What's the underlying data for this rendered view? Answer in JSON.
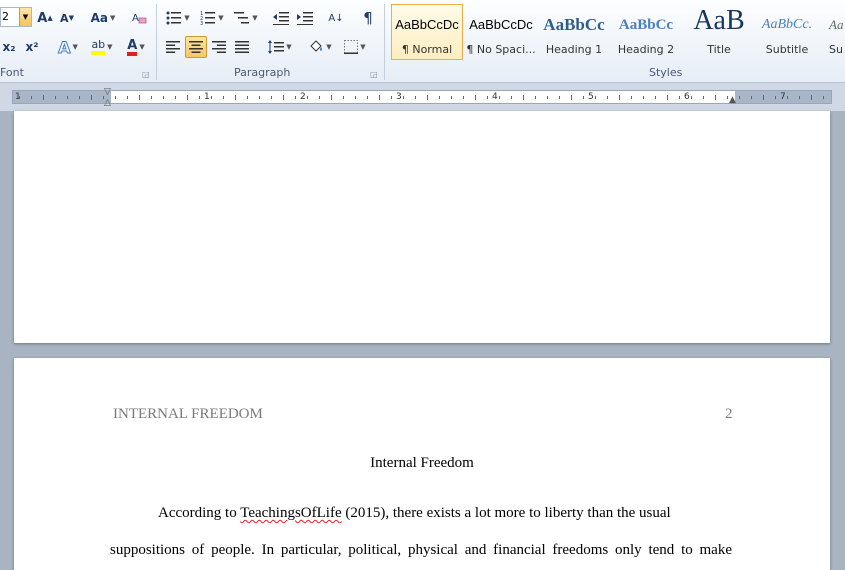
{
  "ribbon": {
    "font_group": {
      "label": "Font",
      "font_size": "2",
      "grow_font": "A",
      "shrink_font": "A",
      "change_case": "Aa",
      "subscript": "x₂",
      "superscript": "x²",
      "text_effects": "A",
      "highlight": "ab",
      "font_color": "A",
      "font_color_hex": "#e02020",
      "highlight_hex": "#ffff00"
    },
    "paragraph_group": {
      "label": "Paragraph",
      "sort": "A↓",
      "show_marks": "¶"
    },
    "styles_group": {
      "label": "Styles",
      "items": [
        {
          "sample": "AaBbCcDc",
          "name": "¶ Normal"
        },
        {
          "sample": "AaBbCcDc",
          "name": "¶ No Spaci..."
        },
        {
          "sample": "AaBbCc",
          "name": "Heading 1"
        },
        {
          "sample": "AaBbCc",
          "name": "Heading 2"
        },
        {
          "sample": "AaB",
          "name": "Title"
        },
        {
          "sample": "AaBbCc.",
          "name": "Subtitle"
        },
        {
          "sample": "Aa",
          "name": "Sub"
        }
      ]
    }
  },
  "ruler": {
    "numbers": [
      "1",
      "1",
      "2",
      "3",
      "4",
      "5",
      "6",
      "7"
    ]
  },
  "document": {
    "running_head": "INTERNAL FREEDOM",
    "page_number": "2",
    "title": "Internal Freedom",
    "paragraph": {
      "line1_before": "According to ",
      "line1_flagged": "TeachingsOfLife",
      "line1_after": " (2015), there exists a lot more to liberty than the usual",
      "line2": "suppositions of people. In particular, political, physical and financial freedoms only tend to make"
    }
  }
}
